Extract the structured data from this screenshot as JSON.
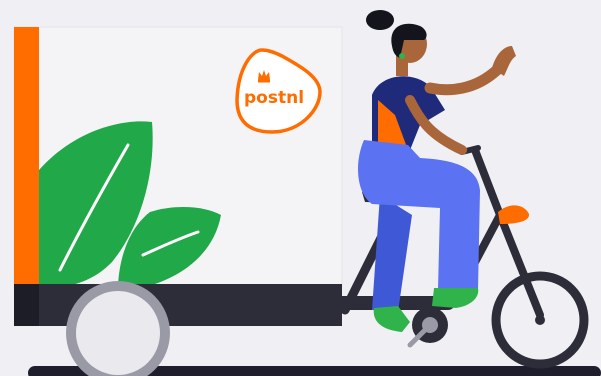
{
  "brand": {
    "name": "postnl",
    "logo_icon": "crown-icon"
  },
  "scene": {
    "subject": "cargo-e-bike-delivery-illustration"
  },
  "colors": {
    "background": "#f0f0f4",
    "brand_orange": "#ff6c00",
    "cargo_box": "#f4f4f7",
    "dark": "#2d2d3a",
    "leaf_green": "#21a849",
    "pants": "#5b72f2",
    "shirt": "#1f2a7a",
    "skin": "#a9663b",
    "shoes": "#30b34a"
  }
}
